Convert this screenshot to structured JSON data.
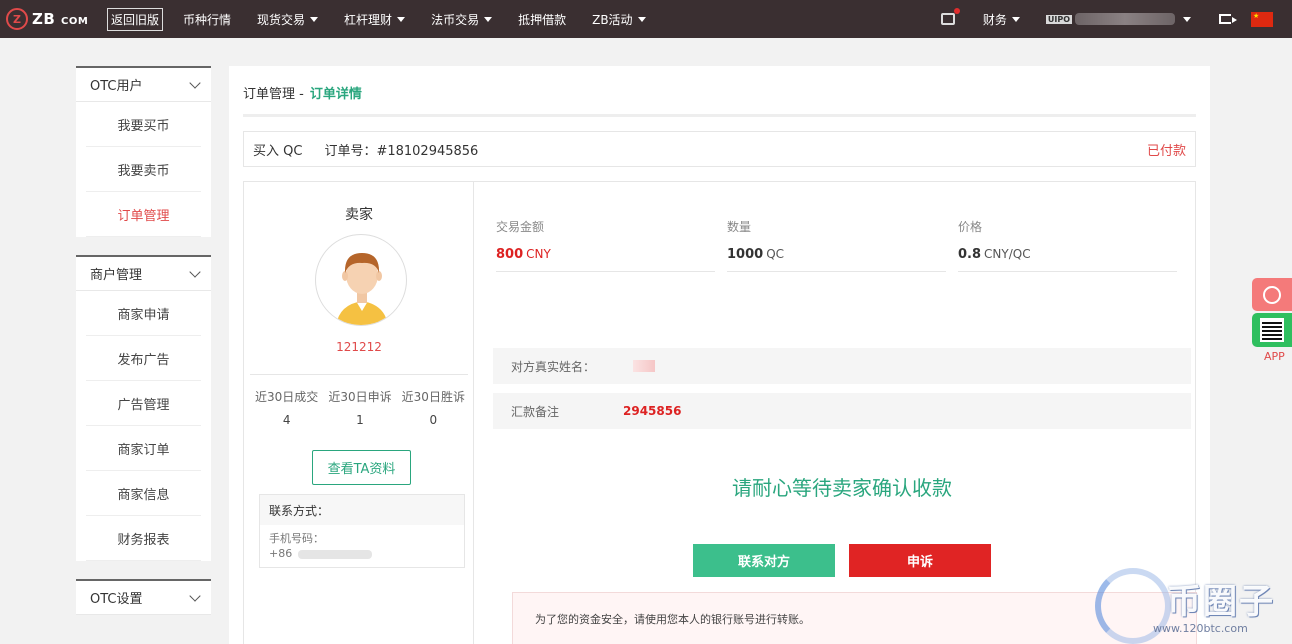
{
  "header": {
    "logo_mark": "Z",
    "logo_text": "ZB",
    "logo_suffix": "COM",
    "old_version": "返回旧版",
    "nav": [
      {
        "label": "币种行情",
        "caret": false
      },
      {
        "label": "现货交易",
        "caret": true
      },
      {
        "label": "杠杆理财",
        "caret": true
      },
      {
        "label": "法币交易",
        "caret": true
      },
      {
        "label": "抵押借款",
        "caret": false
      },
      {
        "label": "ZB活动",
        "caret": true
      }
    ],
    "finance": "财务",
    "user_badge": "UIPO"
  },
  "sidebar": {
    "groups": [
      {
        "title": "OTC用户",
        "items": [
          "我要买币",
          "我要卖币",
          "订单管理"
        ],
        "active": 2
      },
      {
        "title": "商户管理",
        "items": [
          "商家申请",
          "发布广告",
          "广告管理",
          "商家订单",
          "商家信息",
          "财务报表"
        ],
        "active": -1
      },
      {
        "title": "OTC设置",
        "items": [],
        "active": -1
      }
    ]
  },
  "breadcrumb": {
    "parent": "订单管理 -",
    "current": "订单详情"
  },
  "order": {
    "side": "买入 QC",
    "number_label": "订单号：#18102945856",
    "status": "已付款"
  },
  "seller": {
    "title": "卖家",
    "name": "121212",
    "stats": [
      {
        "label": "近30日成交",
        "value": "4"
      },
      {
        "label": "近30日申诉",
        "value": "1"
      },
      {
        "label": "近30日胜诉",
        "value": "0"
      }
    ],
    "view_button": "查看TA资料",
    "contact_title": "联系方式：",
    "phone_label": "手机号码：",
    "phone_prefix": "+86"
  },
  "trade": {
    "amount_label": "交易金额",
    "amount_value": "800",
    "amount_unit": "CNY",
    "qty_label": "数量",
    "qty_value": "1000",
    "qty_unit": "QC",
    "price_label": "价格",
    "price_value": "0.8",
    "price_unit": "CNY/QC"
  },
  "payee": {
    "name_label": "对方真实姓名：",
    "remark_label": "汇款备注",
    "remark_value": "2945856"
  },
  "status_message": "请耐心等待卖家确认收款",
  "buttons": {
    "contact": "联系对方",
    "appeal": "申诉"
  },
  "notice": "为了您的资金安全，请使用您本人的银行账号进行转账。",
  "float": {
    "app_label": "APP"
  },
  "watermark": {
    "text": "币圈子",
    "url": "www.120btc.com"
  },
  "colors": {
    "accent_green": "#2aa67e",
    "alert_red": "#e04a4a",
    "topbar": "#3a2f31"
  }
}
